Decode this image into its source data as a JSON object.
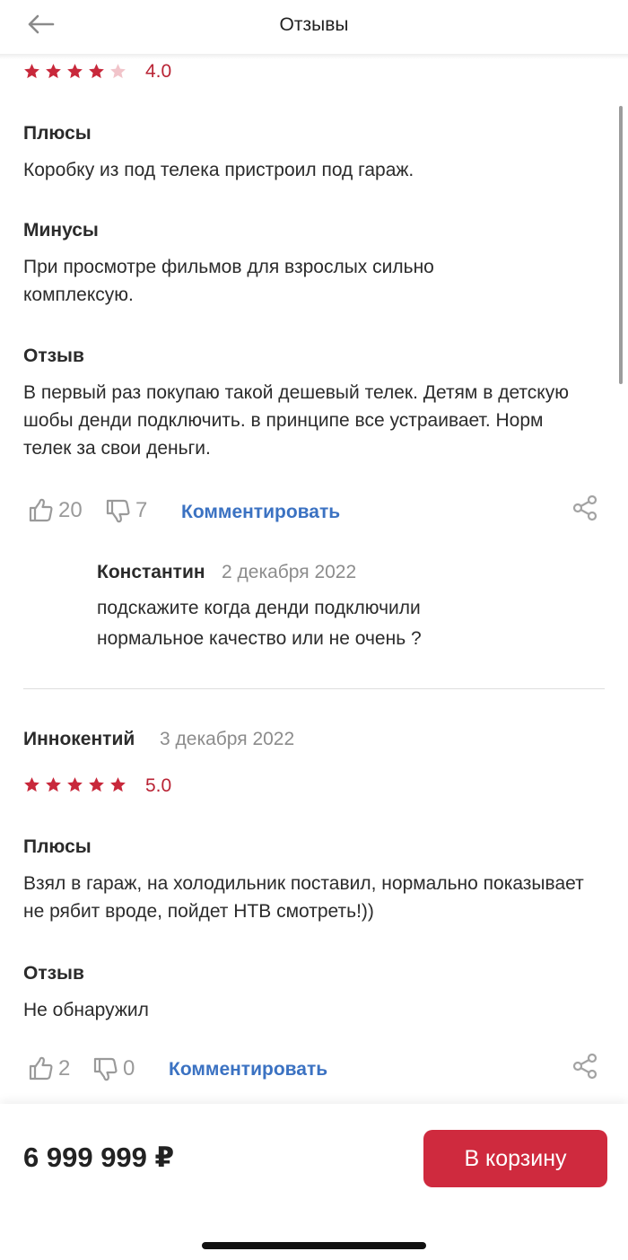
{
  "header": {
    "title": "Отзывы",
    "back_icon": "arrow-left-icon"
  },
  "colors": {
    "accent_red": "#cf2a3e",
    "rating_red": "#b92334",
    "link_blue": "#3b72c2",
    "muted_gray": "#8c8c8c"
  },
  "reviews": [
    {
      "rating": 4,
      "rating_label": "4.0",
      "sections": [
        {
          "title": "Плюсы",
          "text": "Коробку из под телека пристроил под гараж."
        },
        {
          "title": "Минусы",
          "text": "При просмотре фильмов для взрослых сильно комплексую."
        },
        {
          "title": "Отзыв",
          "text": "В первый раз покупаю такой дешевый телек. Детям в детскую шобы денди подключить. в принципе все устраивает. Норм телек за свои деньги."
        }
      ],
      "likes": "20",
      "dislikes": "7",
      "comment_label": "Комментировать",
      "reply": {
        "author": "Константин",
        "date": "2 декабря 2022",
        "text": "подскажите когда денди подключили нормальное качество или не очень ?"
      }
    },
    {
      "author": "Иннокентий",
      "date": "3 декабря 2022",
      "rating": 5,
      "rating_label": "5.0",
      "sections": [
        {
          "title": "Плюсы",
          "text": "Взял в гараж, на холодильник поставил, нормально показывает не рябит вроде, пойдет НТВ смотреть!))"
        },
        {
          "title": "Отзыв",
          "text": "Не обнаружил"
        }
      ],
      "likes": "2",
      "dislikes": "0",
      "comment_label": "Комментировать"
    }
  ],
  "bottom": {
    "price": "6 999 999 ₽",
    "cart_button": "В корзину"
  }
}
